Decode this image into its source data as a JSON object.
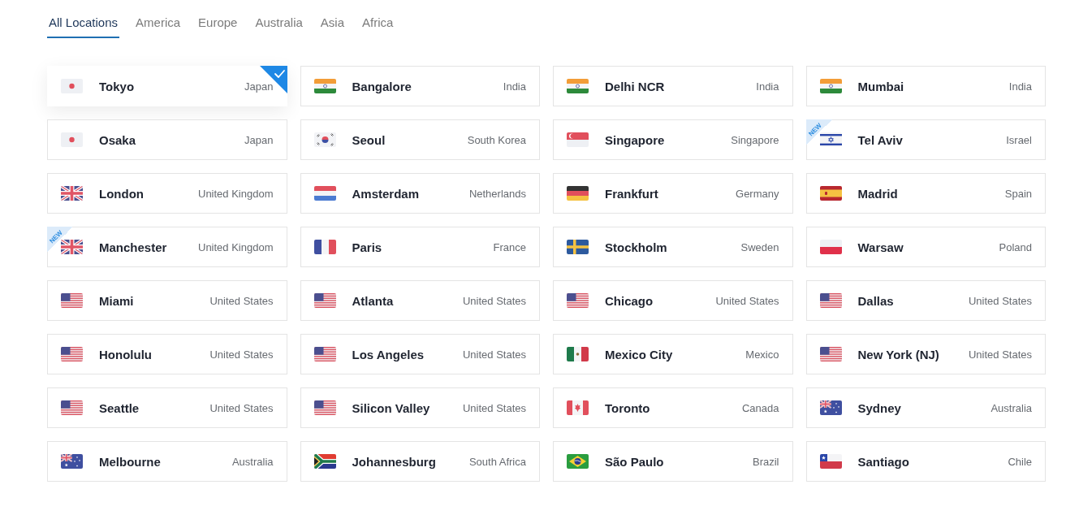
{
  "tabs": [
    {
      "label": "All Locations",
      "selected": true
    },
    {
      "label": "America",
      "selected": false
    },
    {
      "label": "Europe",
      "selected": false
    },
    {
      "label": "Australia",
      "selected": false
    },
    {
      "label": "Asia",
      "selected": false
    },
    {
      "label": "Africa",
      "selected": false
    }
  ],
  "locations": [
    {
      "city": "Tokyo",
      "country": "Japan",
      "kind": "japan",
      "selected": true
    },
    {
      "city": "Bangalore",
      "country": "India",
      "kind": "india",
      "selected": false
    },
    {
      "city": "Delhi NCR",
      "country": "India",
      "kind": "india",
      "selected": false
    },
    {
      "city": "Mumbai",
      "country": "India",
      "kind": "india",
      "selected": false
    },
    {
      "city": "Osaka",
      "country": "Japan",
      "kind": "japan",
      "selected": false
    },
    {
      "city": "Seoul",
      "country": "South Korea",
      "kind": "korea",
      "selected": false
    },
    {
      "city": "Singapore",
      "country": "Singapore",
      "kind": "singapore",
      "selected": false
    },
    {
      "city": "Tel Aviv",
      "country": "Israel",
      "kind": "israel",
      "selected": false,
      "badge": "NEW"
    },
    {
      "city": "London",
      "country": "United Kingdom",
      "kind": "uk",
      "selected": false
    },
    {
      "city": "Amsterdam",
      "country": "Netherlands",
      "kind": "netherlands",
      "selected": false
    },
    {
      "city": "Frankfurt",
      "country": "Germany",
      "kind": "germany",
      "selected": false
    },
    {
      "city": "Madrid",
      "country": "Spain",
      "kind": "spain",
      "selected": false
    },
    {
      "city": "Manchester",
      "country": "United Kingdom",
      "kind": "uk",
      "selected": false,
      "badge": "NEW"
    },
    {
      "city": "Paris",
      "country": "France",
      "kind": "france",
      "selected": false
    },
    {
      "city": "Stockholm",
      "country": "Sweden",
      "kind": "sweden",
      "selected": false
    },
    {
      "city": "Warsaw",
      "country": "Poland",
      "kind": "poland",
      "selected": false
    },
    {
      "city": "Miami",
      "country": "United States",
      "kind": "usa",
      "selected": false
    },
    {
      "city": "Atlanta",
      "country": "United States",
      "kind": "usa",
      "selected": false
    },
    {
      "city": "Chicago",
      "country": "United States",
      "kind": "usa",
      "selected": false
    },
    {
      "city": "Dallas",
      "country": "United States",
      "kind": "usa",
      "selected": false
    },
    {
      "city": "Honolulu",
      "country": "United States",
      "kind": "usa",
      "selected": false
    },
    {
      "city": "Los Angeles",
      "country": "United States",
      "kind": "usa",
      "selected": false
    },
    {
      "city": "Mexico City",
      "country": "Mexico",
      "kind": "mexico",
      "selected": false
    },
    {
      "city": "New York (NJ)",
      "country": "United States",
      "kind": "usa",
      "selected": false
    },
    {
      "city": "Seattle",
      "country": "United States",
      "kind": "usa",
      "selected": false
    },
    {
      "city": "Silicon Valley",
      "country": "United States",
      "kind": "usa",
      "selected": false
    },
    {
      "city": "Toronto",
      "country": "Canada",
      "kind": "canada",
      "selected": false
    },
    {
      "city": "Sydney",
      "country": "Australia",
      "kind": "australia",
      "selected": false
    },
    {
      "city": "Melbourne",
      "country": "Australia",
      "kind": "australia",
      "selected": false
    },
    {
      "city": "Johannesburg",
      "country": "South Africa",
      "kind": "southafrica",
      "selected": false
    },
    {
      "city": "São Paulo",
      "country": "Brazil",
      "kind": "brazil",
      "selected": false
    },
    {
      "city": "Santiago",
      "country": "Chile",
      "kind": "chile",
      "selected": false
    }
  ]
}
